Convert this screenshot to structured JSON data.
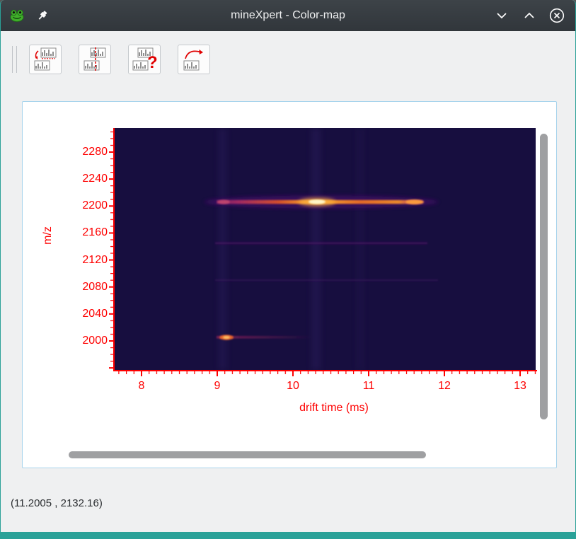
{
  "colors": {
    "accent_teal": "#2aa198",
    "titlebar_background": "#31363b",
    "axis_red": "#ff0000",
    "heatmap_background": "#170e3f",
    "panel_border_blue": "#a8d4ec"
  },
  "titlebar": {
    "title": "mineXpert - Color-map",
    "icons": [
      "app-frog-icon",
      "pin-icon",
      "minimize-icon",
      "maximize-icon",
      "close-icon"
    ]
  },
  "toolbar": {
    "buttons": [
      {
        "icon": "colormap-to-spectrum-down-arrow-icon"
      },
      {
        "icon": "colormap-slice-dashed-line-icon"
      },
      {
        "icon": "colormap-question-help-icon"
      },
      {
        "icon": "spectrum-arc-arrow-icon"
      }
    ]
  },
  "statusbar": {
    "coordinates": "(11.2005 , 2132.16)"
  },
  "chart_data": {
    "type": "heatmap",
    "title": "",
    "xlabel": "drift time (ms)",
    "ylabel": "m/z",
    "xlim": [
      7.65,
      13.2
    ],
    "ylim": [
      1957,
      2316
    ],
    "xticks": [
      8,
      9,
      10,
      11,
      12,
      13
    ],
    "xtick_labels": [
      "8",
      "9",
      "10",
      "11",
      "12",
      "13"
    ],
    "yticks": [
      2000,
      2040,
      2080,
      2120,
      2160,
      2200,
      2240,
      2280
    ],
    "ytick_labels": [
      "2280",
      "2240",
      "2200",
      "2160",
      "2120",
      "2080",
      "2040",
      "2000"
    ],
    "grid": false,
    "legend": "none",
    "colormap": "inferno-like glow on dark indigo background",
    "axis_color": "#ff0000",
    "features": [
      {
        "kind": "horizontal_band",
        "mz": 2206,
        "drift_start": 9.0,
        "drift_end": 11.75,
        "intensity": "high",
        "hotspots": [
          {
            "drift": 10.32,
            "intensity": "maximum (white-yellow core)"
          },
          {
            "drift": 11.6,
            "intensity": "high (orange)"
          },
          {
            "drift": 9.1,
            "intensity": "medium (magenta)"
          }
        ]
      },
      {
        "kind": "spot",
        "mz": 2005,
        "drift": 9.12,
        "intensity": "high (orange)"
      },
      {
        "kind": "horizontal_band",
        "mz": 2005,
        "drift_start": 9.0,
        "drift_end": 10.5,
        "intensity": "low (fading right)"
      },
      {
        "kind": "horizontal_band",
        "mz": 2145,
        "drift_start": 9.0,
        "drift_end": 11.7,
        "intensity": "faint purple"
      },
      {
        "kind": "horizontal_band",
        "mz": 2090,
        "drift_start": 9.0,
        "drift_end": 11.8,
        "intensity": "very faint"
      },
      {
        "kind": "vertical_smear",
        "drift": 9.1,
        "intensity": "faint"
      },
      {
        "kind": "vertical_smear",
        "drift": 10.32,
        "intensity": "faint"
      },
      {
        "kind": "vertical_smear",
        "drift": 10.95,
        "intensity": "very faint"
      }
    ]
  }
}
